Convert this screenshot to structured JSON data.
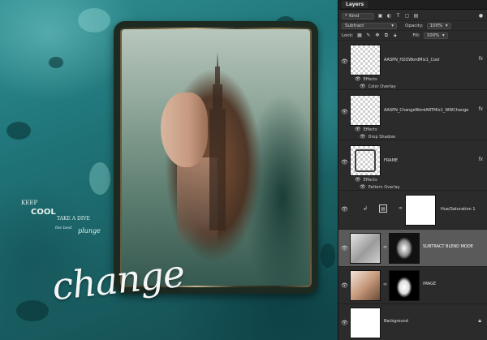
{
  "canvas": {
    "word_cluster": [
      "KEEP",
      "COOL",
      "TAKE A DIVE",
      "the best",
      "plunge"
    ],
    "title_word": "change"
  },
  "layers_panel": {
    "tab": "Layers",
    "filter_kind": "Kind",
    "blend_mode": "Subtract",
    "opacity_label": "Opacity:",
    "opacity_value": "100%",
    "lock_label": "Lock:",
    "fill_label": "Fill:",
    "fill_value": "100%",
    "layers": [
      {
        "name": "AASPN_H2OWordMix1_Cool",
        "fx": "fx",
        "effects_label": "Effects",
        "effect": "Color Overlay"
      },
      {
        "name": "AASPN_ChangeWordARTMix1_WWChange",
        "fx": "fx",
        "effects_label": "Effects",
        "effect": "Drop Shadow"
      },
      {
        "name": "FRAME",
        "fx": "fx",
        "effects_label": "Effects",
        "effect": "Pattern Overlay"
      },
      {
        "name": "Hue/Saturation 1"
      },
      {
        "name": "SUBTRACT BLEND MODE"
      },
      {
        "name": "IMAGE"
      },
      {
        "name": "Background"
      }
    ]
  },
  "colors": {
    "canvas_teal": "#1f7478",
    "panel_bg": "#2b2b2b",
    "selected_layer": "#5a5a5a"
  }
}
